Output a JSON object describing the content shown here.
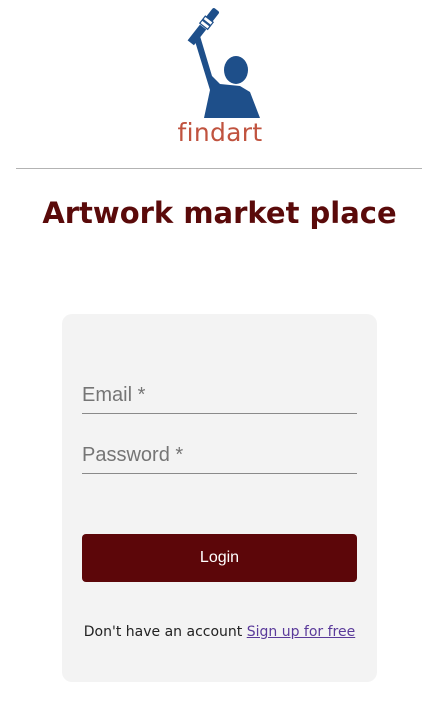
{
  "brand": {
    "logo_text": "findart",
    "logo_color": "#c0533f",
    "figure_color": "#1e4f8a"
  },
  "header": {
    "title": "Artwork market place"
  },
  "login_form": {
    "email_placeholder": "Email *",
    "password_placeholder": "Password *",
    "email_value": "",
    "password_value": "",
    "login_label": "Login",
    "signup_prompt": "Don't have an account ",
    "signup_link": "Sign up for free"
  },
  "colors": {
    "accent": "#5c0609",
    "title": "#5a0a0a",
    "card_bg": "#f3f3f3",
    "link": "#5a3a9a"
  }
}
